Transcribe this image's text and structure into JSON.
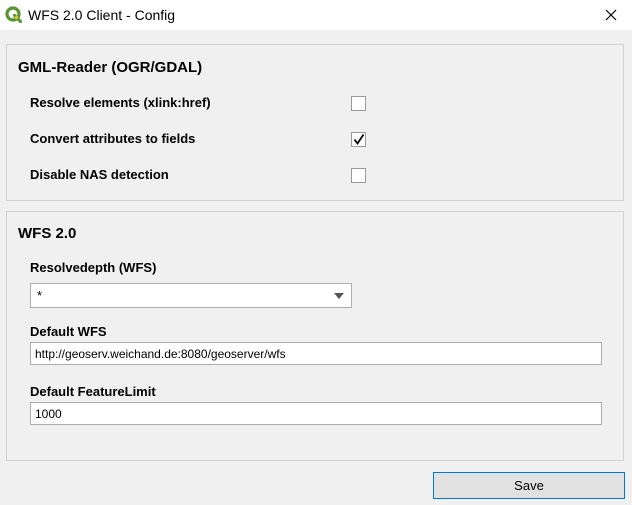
{
  "window": {
    "title": "WFS 2.0 Client - Config",
    "app_icon": "qgis-icon",
    "close_icon": "close-icon"
  },
  "gml_group": {
    "title": "GML-Reader (OGR/GDAL)",
    "options": [
      {
        "label": "Resolve elements (xlink:href)",
        "checked": false
      },
      {
        "label": "Convert attributes to fields",
        "checked": true
      },
      {
        "label": "Disable NAS detection",
        "checked": false
      }
    ]
  },
  "wfs_group": {
    "title": "WFS 2.0",
    "resolvedepth_label": "Resolvedepth (WFS)",
    "resolvedepth_value": "*",
    "default_wfs_label": "Default WFS",
    "default_wfs_value": "http://geoserv.weichand.de:8080/geoserver/wfs",
    "feature_limit_label": "Default FeatureLimit",
    "feature_limit_value": "1000"
  },
  "footer": {
    "save_label": "Save"
  },
  "colors": {
    "accent": "#0078d7",
    "qgis_green": "#589632",
    "qgis_yellow": "#ee7913"
  }
}
